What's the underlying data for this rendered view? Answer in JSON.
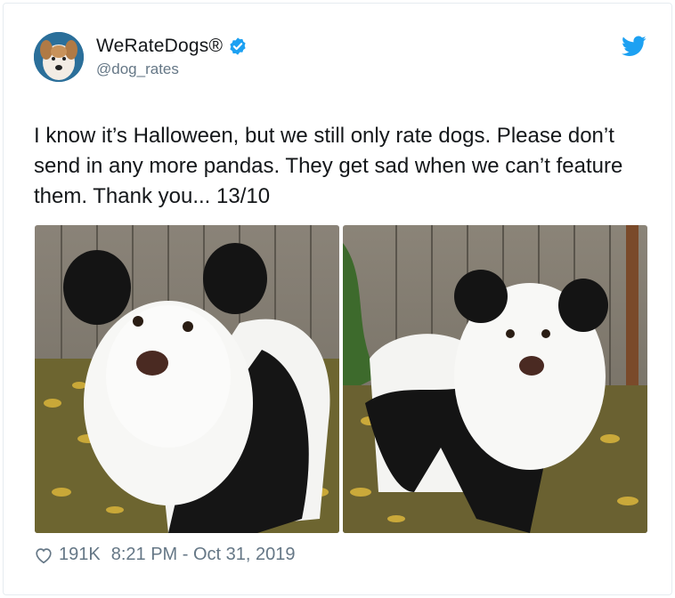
{
  "author": {
    "display_name": "WeRateDogs®",
    "handle": "@dog_rates",
    "verified": true,
    "avatar_icon": "dog-avatar",
    "platform_icon": "twitter-bird-icon"
  },
  "tweet": {
    "text": "I know it’s Halloween, but we still only rate dogs. Please don’t send in any more pandas. They get sad when we can’t feature them. Thank you... 13/10"
  },
  "media": [
    {
      "description_icon": "panda-costume-dog-photo-1"
    },
    {
      "description_icon": "panda-costume-dog-photo-2"
    }
  ],
  "footer": {
    "like_icon": "heart-icon",
    "likes": "191K",
    "timestamp": "8:21 PM - Oct 31, 2019"
  },
  "colors": {
    "twitter_blue": "#1da1f2",
    "text": "#14171a",
    "secondary": "#657786"
  }
}
